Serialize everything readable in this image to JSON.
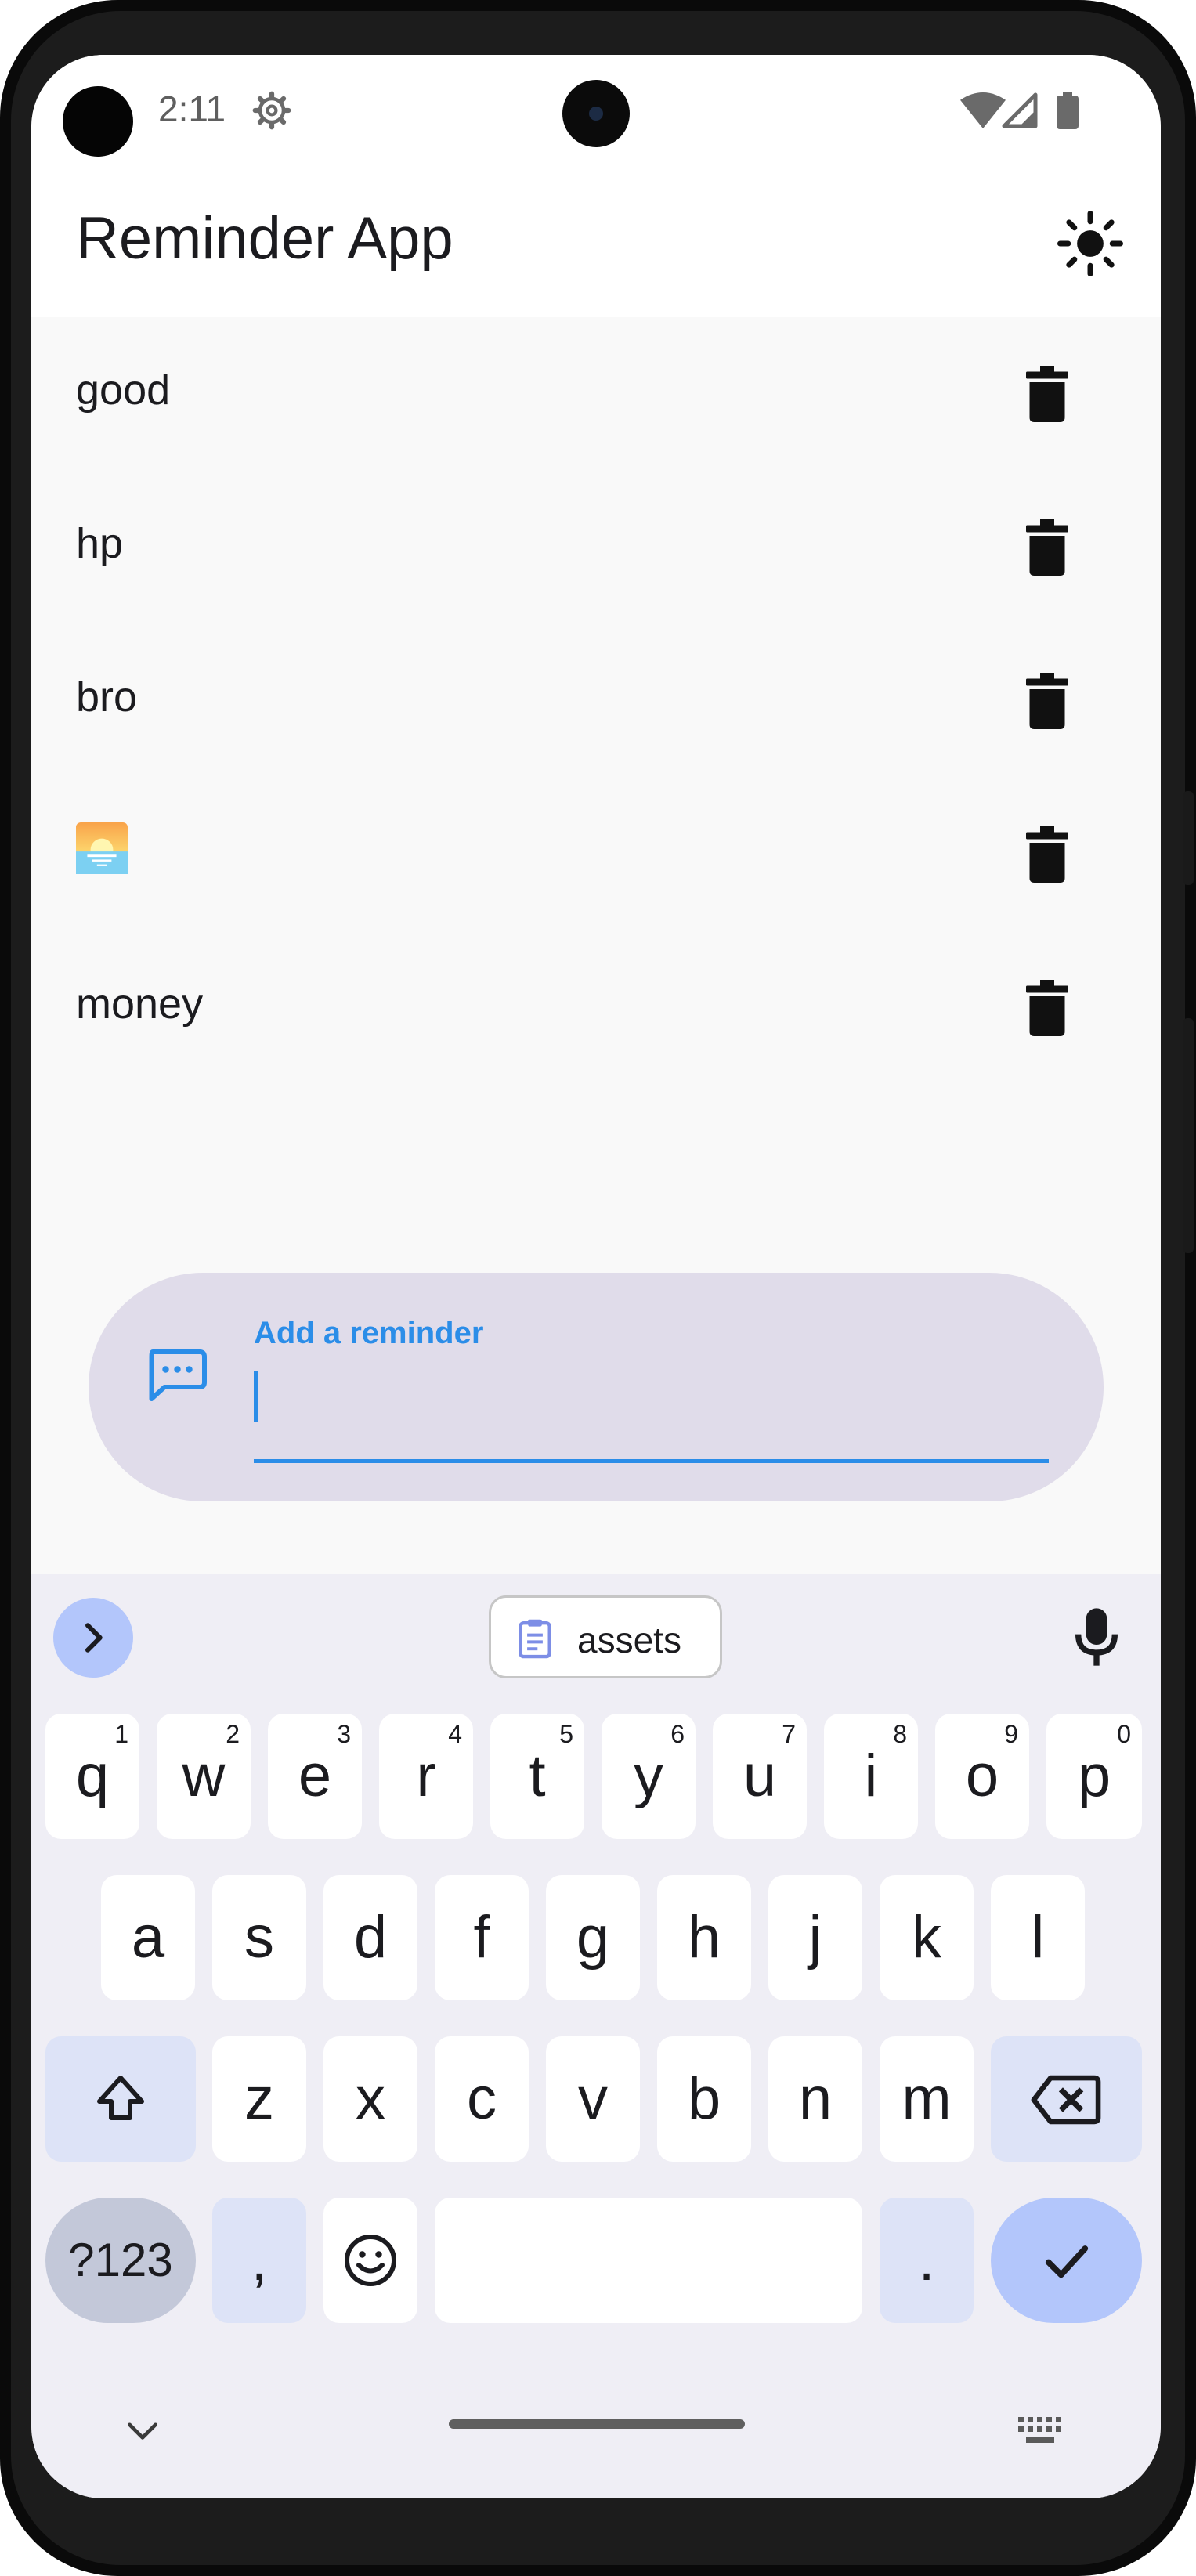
{
  "status_bar": {
    "time": "2:11"
  },
  "app_bar": {
    "title": "Reminder App"
  },
  "reminders": [
    {
      "label": "good",
      "emoji": false
    },
    {
      "label": "hp",
      "emoji": false
    },
    {
      "label": "bro",
      "emoji": false
    },
    {
      "label": "",
      "emoji": true,
      "icon": "sunrise-emoji"
    },
    {
      "label": "money",
      "emoji": false
    }
  ],
  "input": {
    "label": "Add a reminder",
    "value": ""
  },
  "keyboard": {
    "suggestion": "assets",
    "row1": [
      {
        "k": "q",
        "h": "1"
      },
      {
        "k": "w",
        "h": "2"
      },
      {
        "k": "e",
        "h": "3"
      },
      {
        "k": "r",
        "h": "4"
      },
      {
        "k": "t",
        "h": "5"
      },
      {
        "k": "y",
        "h": "6"
      },
      {
        "k": "u",
        "h": "7"
      },
      {
        "k": "i",
        "h": "8"
      },
      {
        "k": "o",
        "h": "9"
      },
      {
        "k": "p",
        "h": "0"
      }
    ],
    "row2": [
      "a",
      "s",
      "d",
      "f",
      "g",
      "h",
      "j",
      "k",
      "l"
    ],
    "row3": [
      "z",
      "x",
      "c",
      "v",
      "b",
      "n",
      "m"
    ],
    "symbols_label": "?123",
    "comma": ",",
    "period": "."
  },
  "colors": {
    "accent": "#2b8de8",
    "input_card": "#e0dcea",
    "keyboard_bg": "#efeef5",
    "key_mod": "#dde3f7",
    "key_enter": "#b3c6fb"
  }
}
